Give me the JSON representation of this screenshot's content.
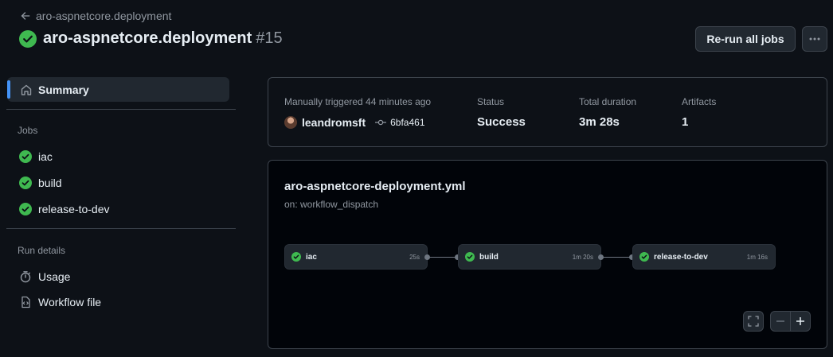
{
  "header": {
    "back_label": "aro-aspnetcore.deployment",
    "title": "aro-aspnetcore.deployment",
    "run_number": "#15",
    "rerun_label": "Re-run all jobs",
    "more_label": "···"
  },
  "sidebar": {
    "summary_label": "Summary",
    "jobs_title": "Jobs",
    "jobs": [
      {
        "label": "iac"
      },
      {
        "label": "build"
      },
      {
        "label": "release-to-dev"
      }
    ],
    "run_details_title": "Run details",
    "details": [
      {
        "label": "Usage",
        "icon": "stopwatch-icon"
      },
      {
        "label": "Workflow file",
        "icon": "file-code-icon"
      }
    ]
  },
  "summary": {
    "trigger_label": "Manually triggered 44 minutes ago",
    "actor": "leandromsft",
    "commit": "6bfa461",
    "status_label": "Status",
    "status_value": "Success",
    "duration_label": "Total duration",
    "duration_value": "3m 28s",
    "artifacts_label": "Artifacts",
    "artifacts_value": "1"
  },
  "workflow": {
    "file": "aro-aspnetcore-deployment.yml",
    "trigger": "on: workflow_dispatch",
    "jobs": [
      {
        "name": "iac",
        "duration": "25s"
      },
      {
        "name": "build",
        "duration": "1m 20s"
      },
      {
        "name": "release-to-dev",
        "duration": "1m 16s"
      }
    ]
  },
  "colors": {
    "success": "#3fb950",
    "accent": "#4493f8",
    "background": "#0d1117"
  }
}
